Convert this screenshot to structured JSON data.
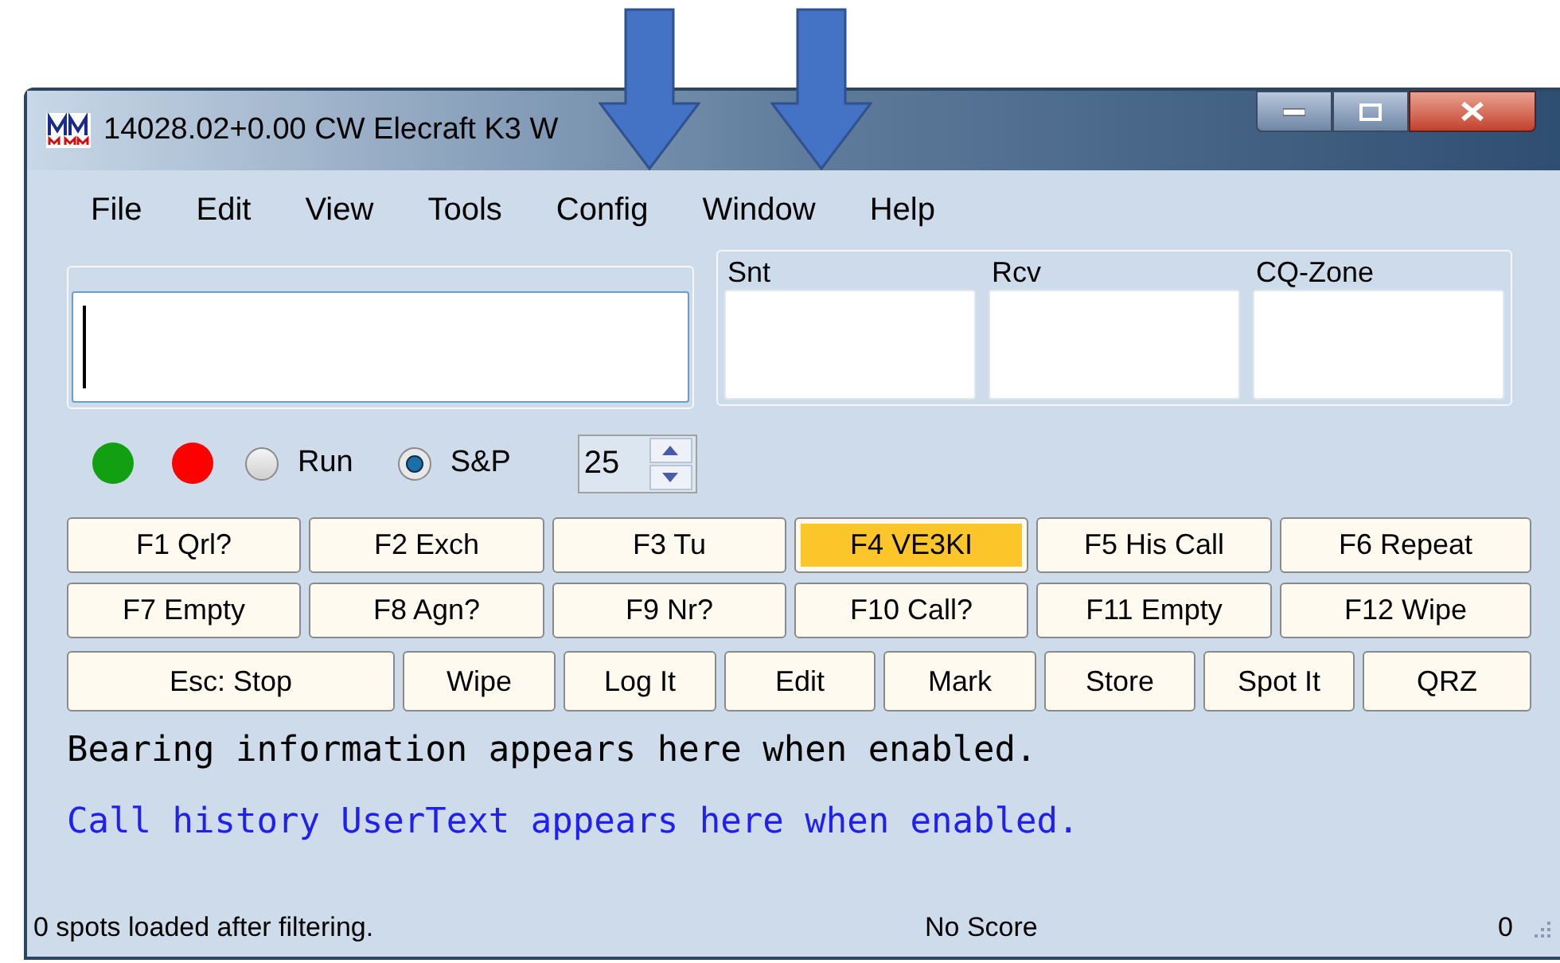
{
  "window": {
    "title": "14028.02+0.00 CW Elecraft K3 W"
  },
  "menu": [
    {
      "label": "File"
    },
    {
      "label": "Edit"
    },
    {
      "label": "View"
    },
    {
      "label": "Tools"
    },
    {
      "label": "Config"
    },
    {
      "label": "Window"
    },
    {
      "label": "Help"
    }
  ],
  "exchange_fields": [
    {
      "label": "Snt"
    },
    {
      "label": "Rcv"
    },
    {
      "label": "CQ-Zone"
    }
  ],
  "indicators": [
    {
      "color": "#12a012"
    },
    {
      "color": "#ff0000"
    }
  ],
  "mode": [
    {
      "label": "Run",
      "selected": false
    },
    {
      "label": "S&P",
      "selected": true
    }
  ],
  "speed": {
    "value": "25"
  },
  "function_keys": [
    {
      "label": "F1 Qrl?",
      "highlighted": false
    },
    {
      "label": "F2 Exch",
      "highlighted": false
    },
    {
      "label": "F3 Tu",
      "highlighted": false
    },
    {
      "label": "F4 VE3KI",
      "highlighted": true
    },
    {
      "label": "F5 His Call",
      "highlighted": false
    },
    {
      "label": "F6 Repeat",
      "highlighted": false
    },
    {
      "label": "F7 Empty",
      "highlighted": false
    },
    {
      "label": "F8 Agn?",
      "highlighted": false
    },
    {
      "label": "F9 Nr?",
      "highlighted": false
    },
    {
      "label": "F10 Call?",
      "highlighted": false
    },
    {
      "label": "F11 Empty",
      "highlighted": false
    },
    {
      "label": "F12 Wipe",
      "highlighted": false
    }
  ],
  "action_buttons": [
    {
      "label": "Esc: Stop"
    },
    {
      "label": "Wipe"
    },
    {
      "label": "Log It"
    },
    {
      "label": "Edit"
    },
    {
      "label": "Mark"
    },
    {
      "label": "Store"
    },
    {
      "label": "Spot It"
    },
    {
      "label": "QRZ"
    }
  ],
  "bearing_text": "Bearing information appears here when enabled.",
  "user_text": "Call history UserText appears here when enabled.",
  "status_bar": {
    "spots": "0 spots loaded after filtering.",
    "score": "No Score",
    "count": "0"
  }
}
